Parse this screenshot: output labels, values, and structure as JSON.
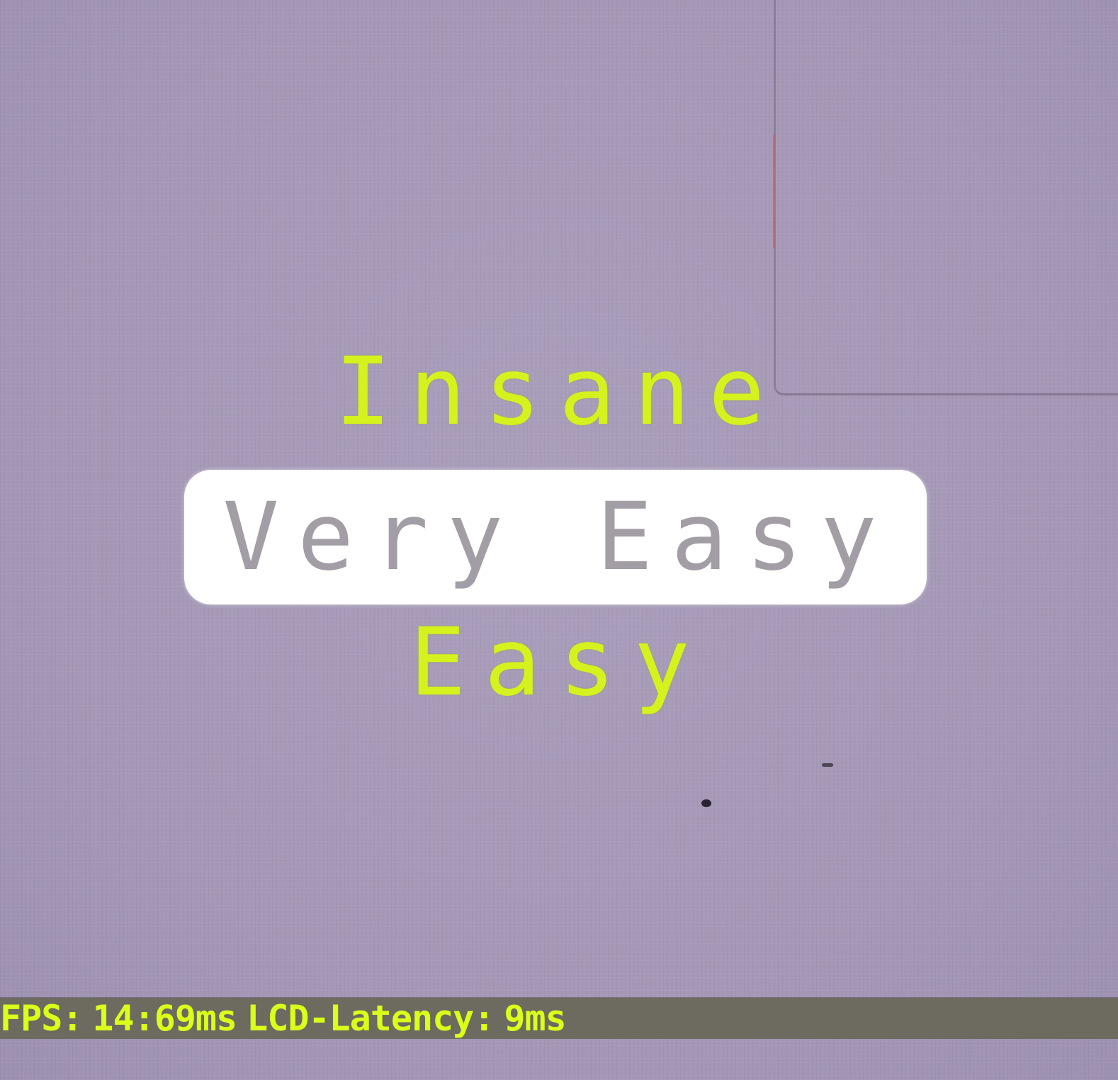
{
  "menu": {
    "above": "Insane",
    "selected": "Very Easy",
    "below": "Easy"
  },
  "debug": {
    "fps_label": "FPS:",
    "fps_value": "14:69ms",
    "latency_label": "LCD-Latency:",
    "latency_value": "9ms"
  },
  "colors": {
    "background": "#a69ab8",
    "option_text": "#d6f21e",
    "selected_bg": "#ffffff",
    "selected_text": "#a39da6",
    "debug_bar": "#6d6a60",
    "debug_text": "#d9ff1a"
  }
}
